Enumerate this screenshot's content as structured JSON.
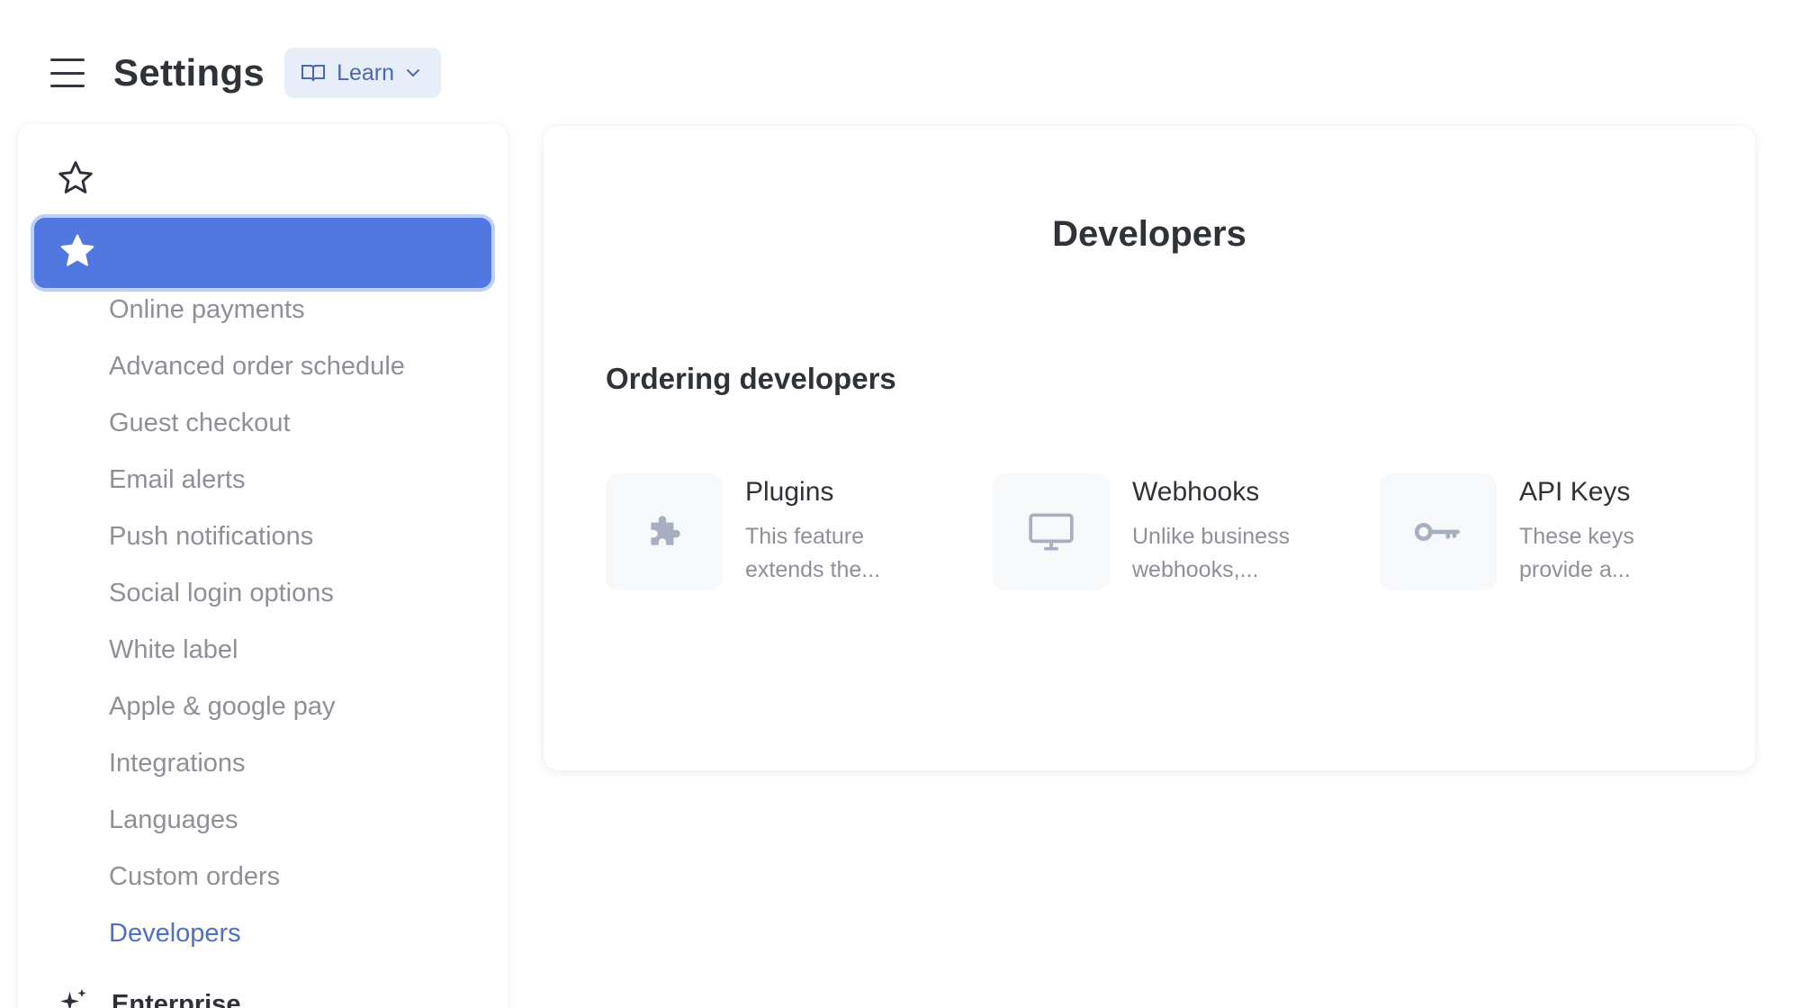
{
  "header": {
    "menu_icon": "hamburger-icon",
    "title": "Settings",
    "learn_button": {
      "label": "Learn",
      "icon": "book-icon",
      "caret_icon": "chevron-down-icon"
    }
  },
  "sidebar": {
    "favorites_icon": "star-outline-icon",
    "active_item_icon": "star-filled-icon",
    "active_item_label": "",
    "sub_items": [
      "Online payments",
      "Advanced order schedule",
      "Guest checkout",
      "Email alerts",
      "Push notifications",
      "Social login options",
      "White label",
      "Apple & google pay",
      "Integrations",
      "Languages",
      "Custom orders",
      "Developers"
    ],
    "current_sub_item": "Developers",
    "enterprise": {
      "label": "Enterprise",
      "icon": "sparkles-icon"
    }
  },
  "main": {
    "title": "Developers",
    "section_title": "Ordering developers",
    "features": [
      {
        "name": "Plugins",
        "icon": "puzzle-icon",
        "desc_line1": "This feature",
        "desc_line2": "extends the..."
      },
      {
        "name": "Webhooks",
        "icon": "monitor-icon",
        "desc_line1": "Unlike business",
        "desc_line2": "webhooks,..."
      },
      {
        "name": "API Keys",
        "icon": "key-icon",
        "desc_line1": "These keys",
        "desc_line2": "provide a..."
      }
    ]
  },
  "colors": {
    "accent": "#5078e0",
    "accent_ring": "#bfd0f7",
    "link": "#4e6fc9",
    "muted_text": "#8d9096",
    "learn_bg": "#e8eef9"
  }
}
